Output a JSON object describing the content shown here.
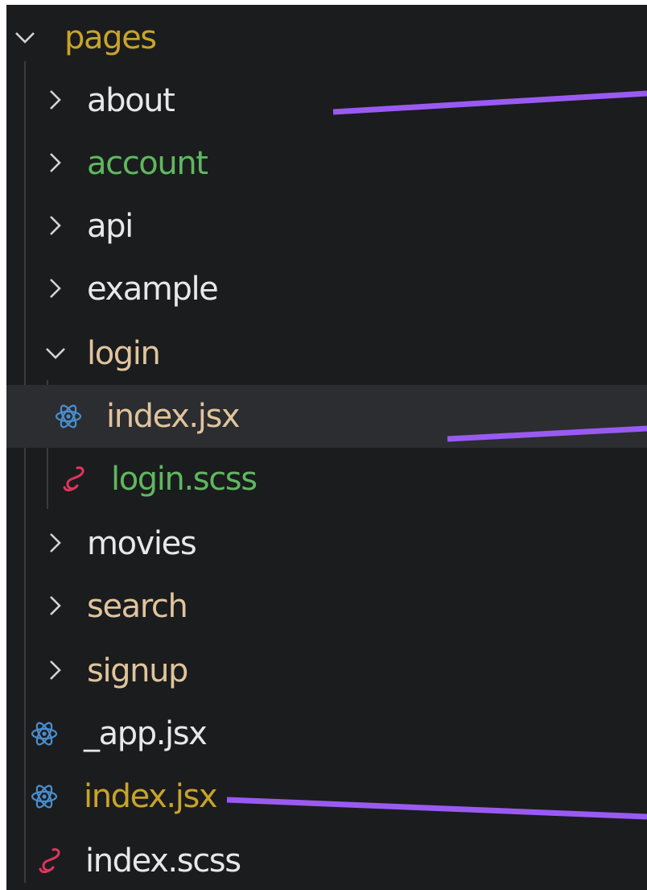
{
  "tree": {
    "root": {
      "label": "pages",
      "color": "#c8a42a",
      "expanded": true
    },
    "children": [
      {
        "label": "about",
        "kind": "folder",
        "expanded": false,
        "color": "#e8e8e8"
      },
      {
        "label": "account",
        "kind": "folder",
        "expanded": false,
        "color": "#5fb85f"
      },
      {
        "label": "api",
        "kind": "folder",
        "expanded": false,
        "color": "#e8e8e8"
      },
      {
        "label": "example",
        "kind": "folder",
        "expanded": false,
        "color": "#e8e8e8"
      },
      {
        "label": "login",
        "kind": "folder",
        "expanded": true,
        "color": "#e0c49c",
        "children": [
          {
            "label": "index.jsx",
            "kind": "file",
            "icon": "react-icon",
            "color": "#e0c49c",
            "selected": true
          },
          {
            "label": "login.scss",
            "kind": "file",
            "icon": "sass-icon",
            "color": "#5fb85f"
          }
        ]
      },
      {
        "label": "movies",
        "kind": "folder",
        "expanded": false,
        "color": "#e8e8e8"
      },
      {
        "label": "search",
        "kind": "folder",
        "expanded": false,
        "color": "#e0c49c"
      },
      {
        "label": "signup",
        "kind": "folder",
        "expanded": false,
        "color": "#e0c49c"
      },
      {
        "label": "_app.jsx",
        "kind": "file",
        "icon": "react-icon",
        "color": "#e8e8e8"
      },
      {
        "label": "index.jsx",
        "kind": "file",
        "icon": "react-icon",
        "color": "#c8a42a"
      },
      {
        "label": "index.scss",
        "kind": "file",
        "icon": "sass-icon",
        "color": "#e8e8e8"
      }
    ]
  },
  "colors": {
    "background": "#1b1c1e",
    "selected_row": "#2b2d30",
    "chevron": "#d4d4d4",
    "react_icon": "#4a8fd0",
    "sass_icon": "#e0345e",
    "annotation_line": "#9a5af2"
  }
}
